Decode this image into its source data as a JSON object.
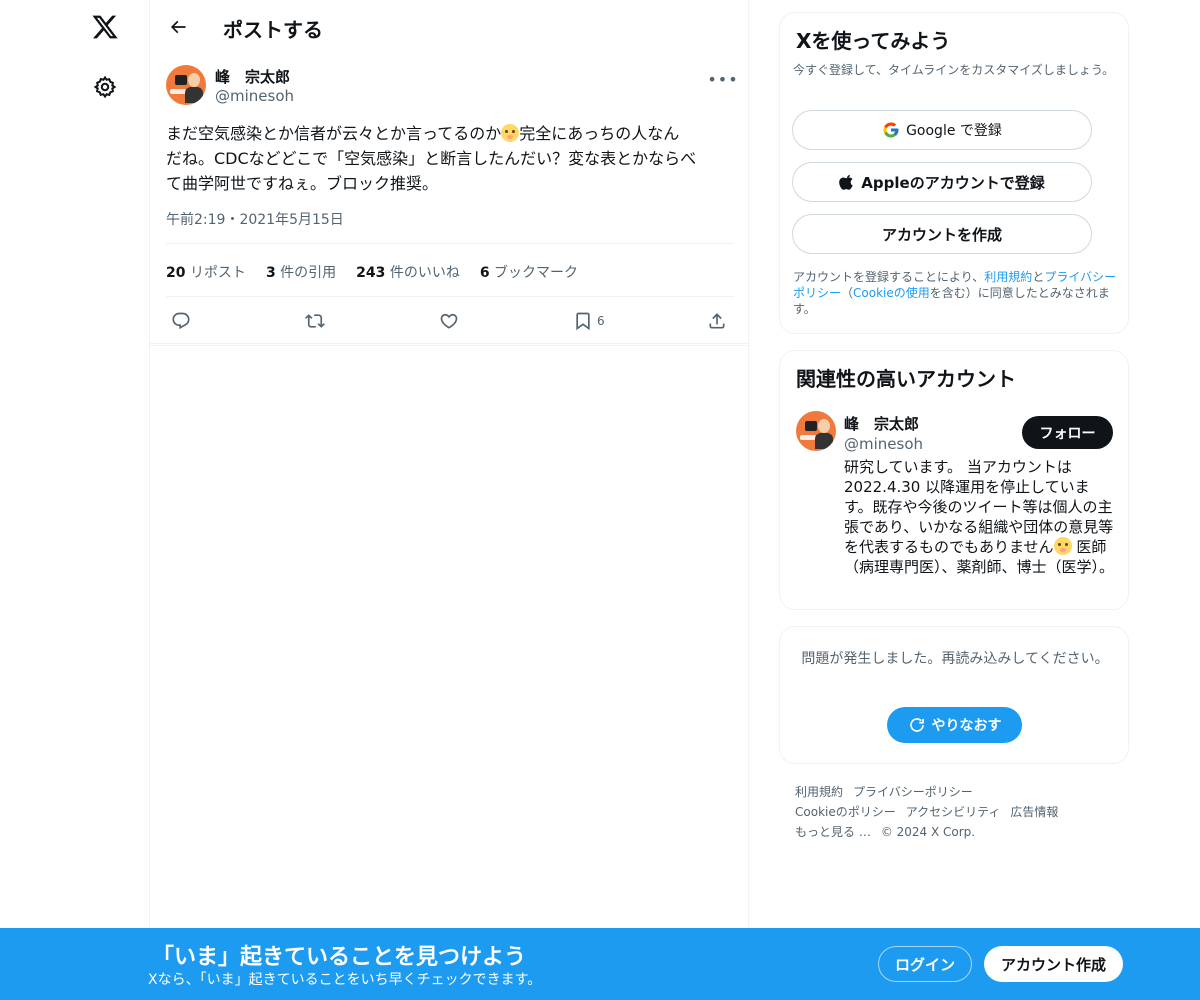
{
  "header": {
    "title": "ポストする"
  },
  "post": {
    "author_name": "峰　宗太郎",
    "author_handle": "@minesoh",
    "text_line1_a": "まだ空気感染とか信者が云々とか言ってるのか",
    "text_line1_b": "完全にあっちの人なん",
    "text_line2": "だね。CDCなどどこで「空気感染」と断言したんだい？変な表とかならべ",
    "text_line3": "て曲学阿世ですねぇ。ブロック推奨。",
    "timestamp": "午前2:19・2021年5月15日",
    "stats": {
      "reposts_count": "20",
      "reposts_label": "リポスト",
      "quotes_count": "3",
      "quotes_label": "件の引用",
      "likes_count": "243",
      "likes_label": "件のいいね",
      "bookmarks_count": "6",
      "bookmarks_label": "ブックマーク"
    },
    "actions": {
      "bookmark_count": "6"
    }
  },
  "signup_card": {
    "title": "Xを使ってみよう",
    "subtitle": "今すぐ登録して、タイムラインをカスタマイズしましょう。",
    "google_label": "Google で登録",
    "apple_label": "Appleのアカウントで登録",
    "create_label": "アカウントを作成",
    "legal_prefix": "アカウントを登録することにより、",
    "legal_terms": "利用規約",
    "legal_and": "と",
    "legal_privacy": "プライバシーポリシー",
    "legal_open": "（",
    "legal_cookie": "Cookieの使用",
    "legal_suffix": "を含む）に同意したとみなされます。"
  },
  "recommend_card": {
    "title": "関連性の高いアカウント",
    "name": "峰　宗太郎",
    "handle": "@minesoh",
    "follow_label": "フォロー",
    "bio_a": "研究しています。 当アカウントは2022.4.30 以降運用を停止しています。既存や今後のツイート等は個人の主張であり、いかなる組織や団体の意見等を代表するものでもありません",
    "bio_b": " 医師（病理専門医）、薬剤師、博士（医学）。"
  },
  "error_card": {
    "message": "問題が発生しました。再読み込みしてください。",
    "retry_label": "やりなおす"
  },
  "footer": {
    "terms": "利用規約",
    "privacy": "プライバシーポリシー",
    "cookie": "Cookieのポリシー",
    "accessibility": "アクセシビリティ",
    "ads": "広告情報",
    "more": "もっと見る …",
    "copyright": "© 2024 X Corp."
  },
  "banner": {
    "title": "「いま」起きていることを見つけよう",
    "subtitle": "Xなら、「いま」起きていることをいち早くチェックできます。",
    "login_label": "ログイン",
    "signup_label": "アカウント作成"
  },
  "colors": {
    "accent": "#1d9bf0",
    "text": "#0f1419",
    "muted": "#536471",
    "border": "#eff3f4"
  },
  "icons": [
    "x-logo-icon",
    "gear-icon",
    "back-arrow-icon",
    "more-icon",
    "reply-icon",
    "repost-icon",
    "like-icon",
    "bookmark-icon",
    "share-icon",
    "google-icon",
    "apple-icon",
    "refresh-icon",
    "emoji-icon"
  ]
}
